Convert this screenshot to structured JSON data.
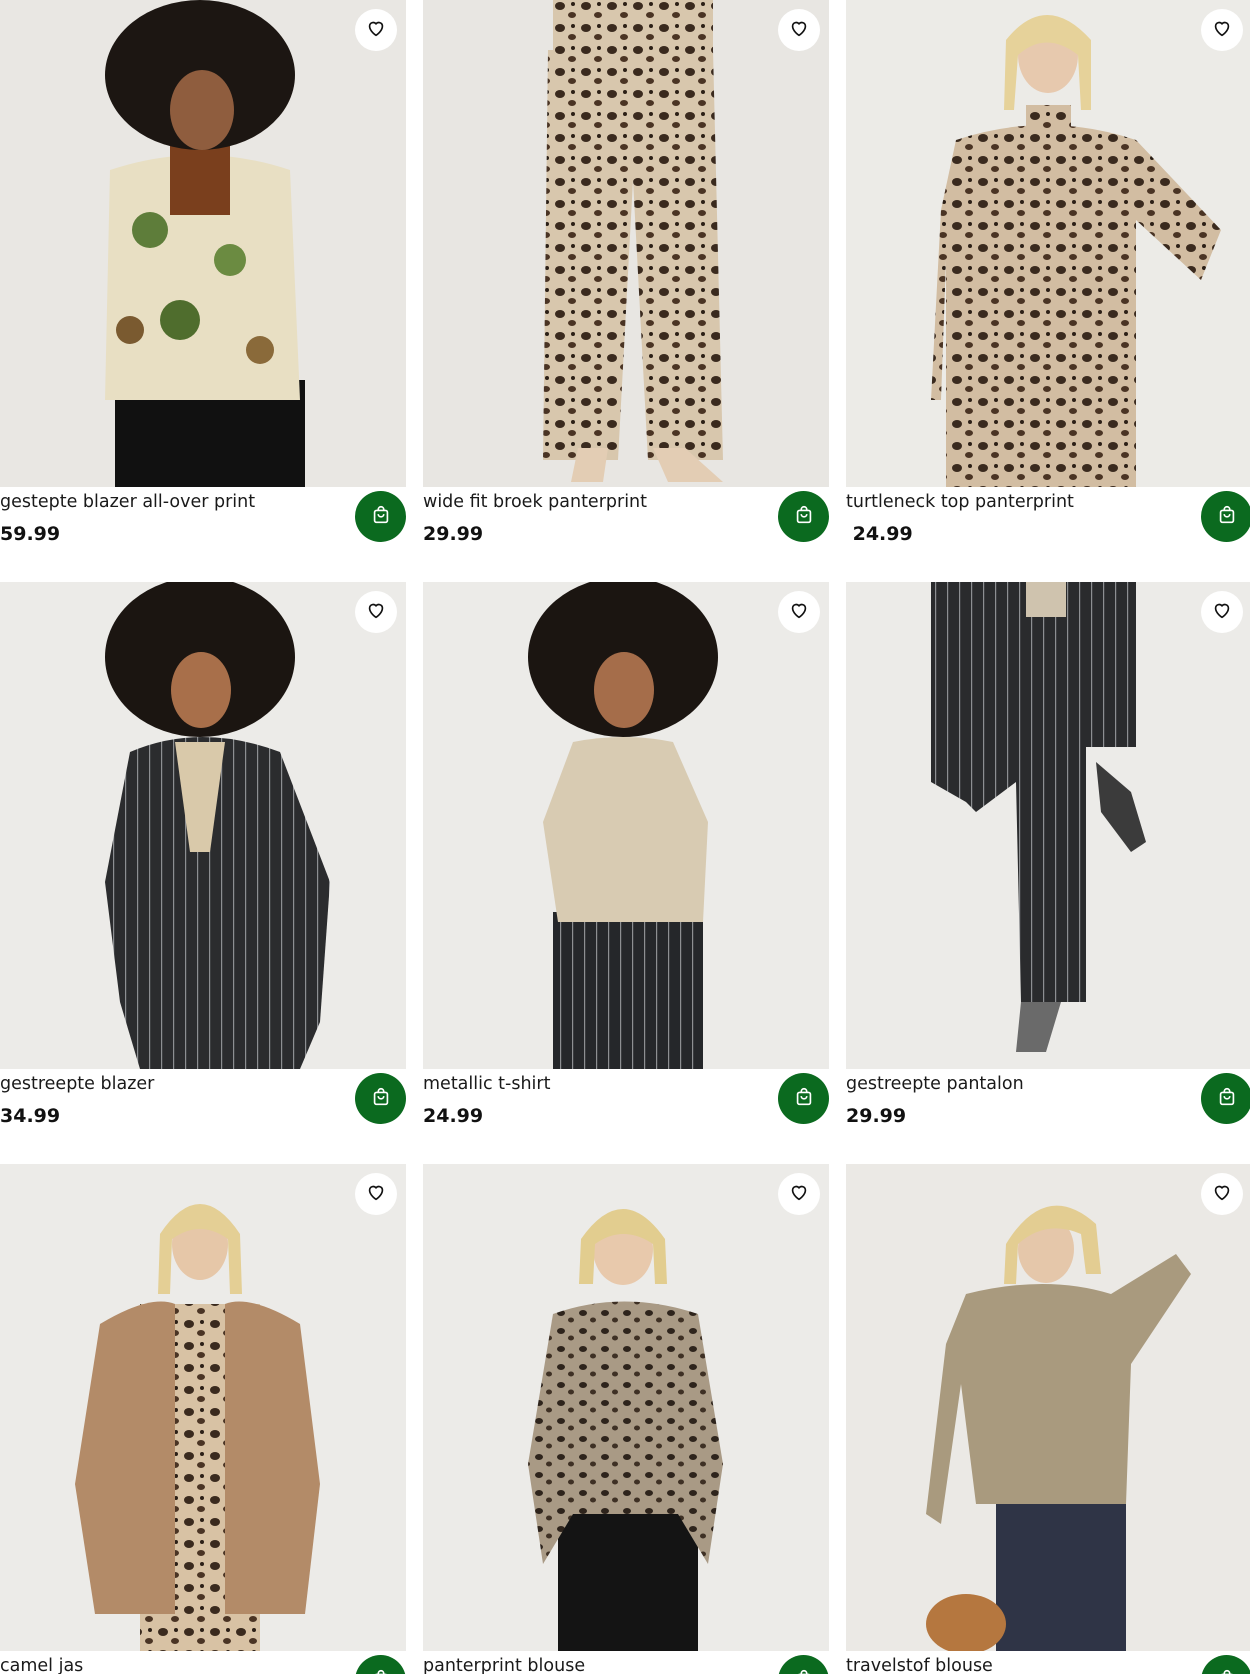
{
  "products": [
    {
      "title": "gestepte blazer all-over print",
      "price": "59.99",
      "icon": "heart-icon",
      "cart_icon": "shopping-bag-icon"
    },
    {
      "title": "wide fit broek panterprint",
      "price": "29.99",
      "icon": "heart-icon",
      "cart_icon": "shopping-bag-icon"
    },
    {
      "title": "turtleneck top panterprint",
      "price": " 24.99",
      "icon": "heart-icon",
      "cart_icon": "shopping-bag-icon"
    },
    {
      "title": "gestreepte blazer",
      "price": "34.99",
      "icon": "heart-icon",
      "cart_icon": "shopping-bag-icon"
    },
    {
      "title": "metallic t-shirt",
      "price": "24.99",
      "icon": "heart-icon",
      "cart_icon": "shopping-bag-icon"
    },
    {
      "title": "gestreepte pantalon",
      "price": "29.99",
      "icon": "heart-icon",
      "cart_icon": "shopping-bag-icon"
    },
    {
      "title": "camel jas",
      "price": "",
      "icon": "heart-icon",
      "cart_icon": "shopping-bag-icon"
    },
    {
      "title": "panterprint blouse",
      "price": "",
      "icon": "heart-icon",
      "cart_icon": "shopping-bag-icon"
    },
    {
      "title": "travelstof blouse",
      "price": "",
      "icon": "heart-icon",
      "cart_icon": "shopping-bag-icon"
    }
  ],
  "colors": {
    "cart_button": "#0b6a1f",
    "background": "#ffffff"
  }
}
